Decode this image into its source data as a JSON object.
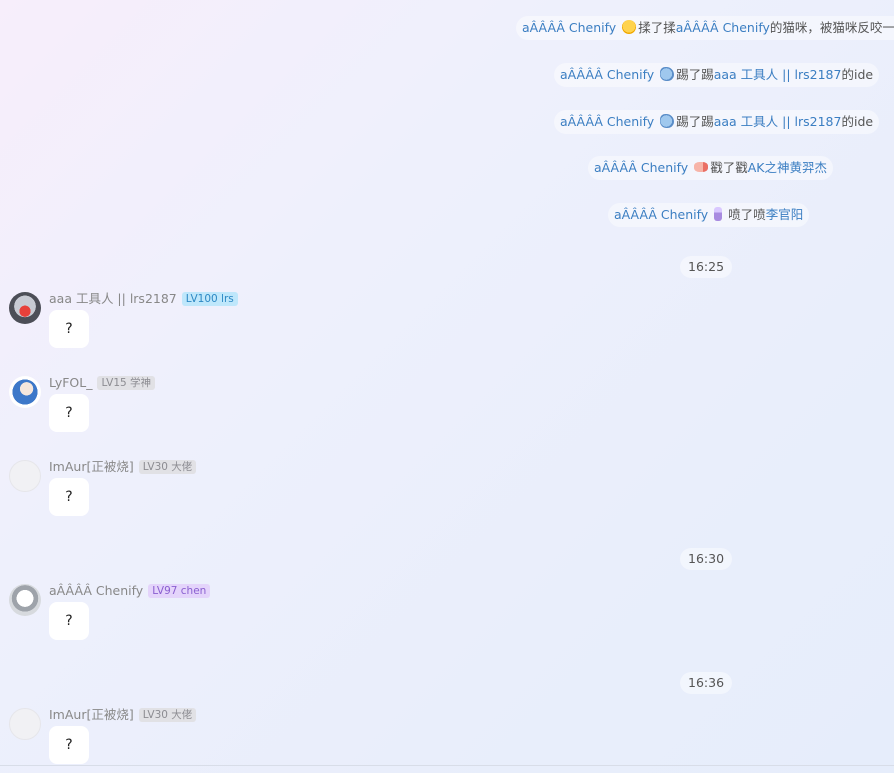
{
  "notices": [
    {
      "actor": "aÂÂÂÂ Chenify",
      "icon": "rub-icon",
      "action": "揉了揉",
      "target": "aÂÂÂÂ Chenify",
      "suffix": "的猫咪，被猫咪反咬一口"
    },
    {
      "actor": "aÂÂÂÂ Chenify",
      "icon": "kick-icon",
      "action": "踢了踢",
      "target": "aaa 工具人 || lrs2187",
      "suffix": "的ide"
    },
    {
      "actor": "aÂÂÂÂ Chenify",
      "icon": "kick-icon",
      "action": "踢了踢",
      "target": "aaa 工具人 || lrs2187",
      "suffix": "的ide"
    },
    {
      "actor": "aÂÂÂÂ Chenify",
      "icon": "poke-icon",
      "action": "戳了戳",
      "target": "AK之神黄羿杰",
      "suffix": ""
    },
    {
      "actor": "aÂÂÂÂ Chenify",
      "icon": "spray-icon",
      "action": "喷了喷",
      "target": "李官阳",
      "suffix": ""
    }
  ],
  "times": [
    "16:25",
    "16:30",
    "16:36"
  ],
  "messages": [
    {
      "sender": "aaa 工具人 || lrs2187",
      "badge": "LV100 lrs",
      "text": "?"
    },
    {
      "sender": "LyFOL_",
      "badge": "LV15 学神",
      "text": "?"
    },
    {
      "sender": "ImAur[正被烧]",
      "badge": "LV30 大佬",
      "text": "?"
    },
    {
      "sender": "aÂÂÂÂ Chenify",
      "badge": "LV97 chen",
      "text": "?"
    },
    {
      "sender": "ImAur[正被烧]",
      "badge": "LV30 大佬",
      "text": "?"
    }
  ]
}
